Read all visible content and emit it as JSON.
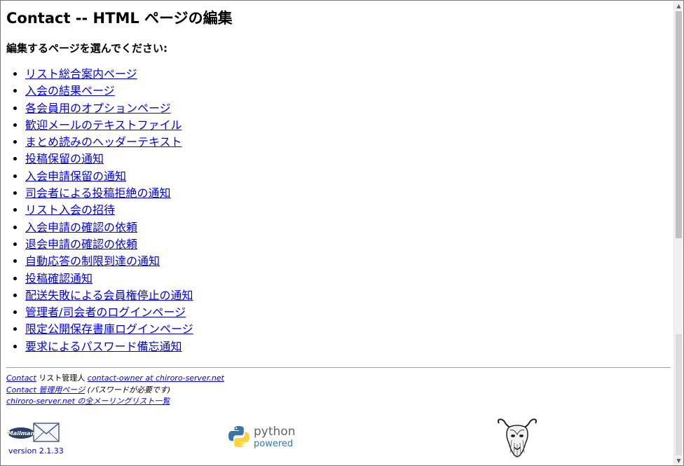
{
  "page": {
    "title": "Contact -- HTML ページの編集",
    "subtitle": "編集するページを選んでください:"
  },
  "links": [
    "リスト総合案内ページ",
    "入会の結果ページ",
    "各会員用のオプションページ",
    "歓迎メールのテキストファイル",
    "まとめ読みのヘッダーテキスト",
    "投稿保留の通知",
    "入会申請保留の通知",
    "司会者による投稿拒絶の通知",
    "リスト入会の招待",
    "入会申請の確認の依頼",
    "退会申請の確認の依頼",
    "自動応答の制限到達の通知",
    "投稿確認通知",
    "配送失敗による会員権停止の通知",
    "管理者/司会者のログインページ",
    "限定公開保存書庫ログインページ",
    "要求によるパスワード備忘通知"
  ],
  "footer": {
    "line1_link1": "Contact",
    "line1_text": " リスト管理人 ",
    "line1_link2": "contact-owner at chiroro-server.net",
    "line2_link": "Contact 管理用ページ",
    "line2_text": " (パスワードが必要です)",
    "line3_link": "chiroro-server.net の全メーリングリスト一覧"
  },
  "logos": {
    "mailman_label": "Mailman",
    "mailman_version": "version 2.1.33",
    "python_word": "python",
    "python_powered": "powered"
  },
  "icons": {
    "scroll_up": "scroll-up-arrow-icon",
    "scroll_down": "scroll-down-arrow-icon"
  },
  "colors": {
    "link": "#0000ee",
    "python_blue": "#3776ab",
    "python_yellow": "#ffd43b"
  }
}
